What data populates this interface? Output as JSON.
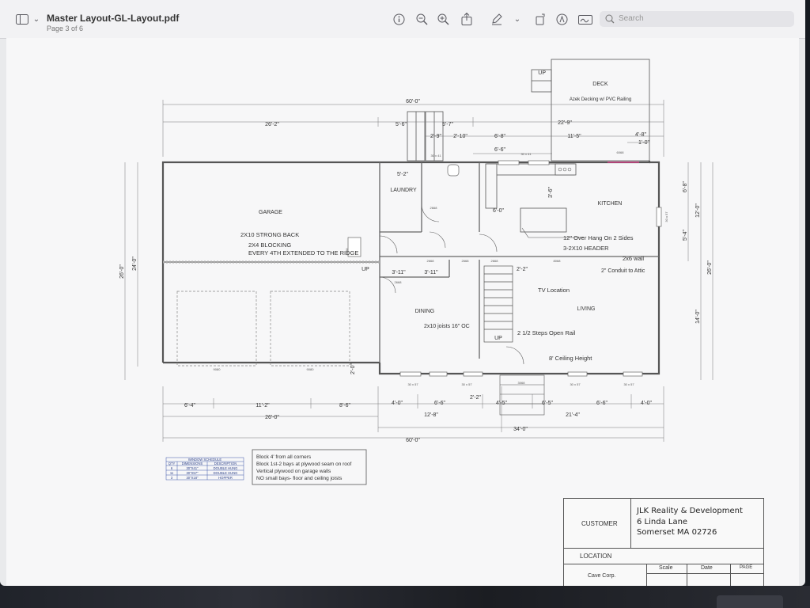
{
  "toolbar": {
    "title": "Master Layout-GL-Layout.pdf",
    "page_info": "Page 3 of 6",
    "search_placeholder": "Search"
  },
  "plan": {
    "rooms": {
      "deck": "DECK",
      "deck_note": "Azek Decking w/ PVC Railing",
      "garage": "GARAGE",
      "laundry": "LAUNDRY",
      "kitchen": "KITCHEN",
      "dining": "DINING",
      "living": "LIVING"
    },
    "notes": {
      "strong_back": "2X10 STRONG BACK",
      "blocking": "2X4 BLOCKING",
      "blocking2": "EVERY 4TH EXTENDED TO THE RIDGE",
      "overhang": "12\" Over Hang On 2 Sides",
      "header": "3-2X10 HEADER",
      "wall": "2x6 wall",
      "conduit": "2\" Conduit to Attic",
      "tv": "TV Location",
      "steps": "2 1/2 Steps Open Rail",
      "ceiling": "8' Ceiling Height",
      "joists": "2x10 joists 16\" OC",
      "up": "UP"
    },
    "dims": {
      "top_60": "60'-0\"",
      "top_26_2": "26'-2\"",
      "top_5_6": "5'-6\"",
      "top_5_7": "5'-7\"",
      "top_22_9": "22'-9\"",
      "top_2_9": "2'-9\"",
      "top_2_10": "2'-10\"",
      "top_6_8": "6'-8\"",
      "top_11_5": "11'-5\"",
      "top_4_8": "4'-8\"",
      "top_1_0": "1'-0\"",
      "top_6_6": "6'-6\"",
      "laundry_5_2": "5'-2\"",
      "kitchen_6_0": "6'-0\"",
      "kitchen_3_6": "3'-6\"",
      "hall_3_11a": "3'-11\"",
      "hall_3_11b": "3'-11\"",
      "hall_2_2": "2'-2\"",
      "left_26_0": "26'-0\"",
      "left_24_0": "24'-0\"",
      "right_6_8": "6'-8\"",
      "right_12_0": "12'-0\"",
      "right_5_4": "5'-4\"",
      "right_26_0": "26'-0\"",
      "right_14_0": "14'-0\"",
      "bot_6_4": "6'-4\"",
      "bot_11_2": "11'-2\"",
      "bot_8_6": "8'-6\"",
      "bot_4_0a": "4'-0\"",
      "bot_6_6a": "6'-6\"",
      "bot_2_2": "2'-2\"",
      "bot_4_5": "4'-5\"",
      "bot_6_5": "6'-5\"",
      "bot_6_6b": "6'-6\"",
      "bot_4_0b": "4'-0\"",
      "bot_26_0": "26'-0\"",
      "bot_12_8": "12'-8\"",
      "bot_21_4": "21'-4\"",
      "bot_34_0": "34'-0\"",
      "bot_60_0": "60'-0\"",
      "garage_2_0": "2'-0\"",
      "win_30x41": "30 x 41",
      "win_30x57": "30 x 57",
      "door_2668": "2668",
      "door_3068": "3068",
      "door_6068": "6068",
      "door_9080": "9080",
      "door_8068": "8068"
    },
    "block_notes": [
      "Block 4' from all corners",
      "Block 1st-2 bays at plywood seam on roof",
      "Vertical plywood on garage walls",
      "NO small bays- floor and ceiling joists"
    ],
    "window_schedule": {
      "title": "WINDOW SCHEDULE",
      "headers": [
        "QTY",
        "DIMENSIONS",
        "DESCRIPTION"
      ],
      "rows": [
        [
          "6",
          "30\"X41\"",
          "DOUBLE HUNG"
        ],
        [
          "11",
          "30\"X57\"",
          "DOUBLE HUNG"
        ],
        [
          "3",
          "30\"X18\"",
          "HOPPER"
        ]
      ]
    }
  },
  "titleblock": {
    "customer_label": "CUSTOMER",
    "customer_line1": "JLK Reality & Development",
    "customer_line2": "6 Linda Lane",
    "customer_line3": "Somerset MA 02726",
    "location_label": "LOCATION",
    "company": "Cave Corp.",
    "scale_label": "Scale",
    "date_label": "Date",
    "page_label": "PAGE"
  },
  "colors": {
    "accent": "#e63b8c",
    "wall": "#555555"
  }
}
